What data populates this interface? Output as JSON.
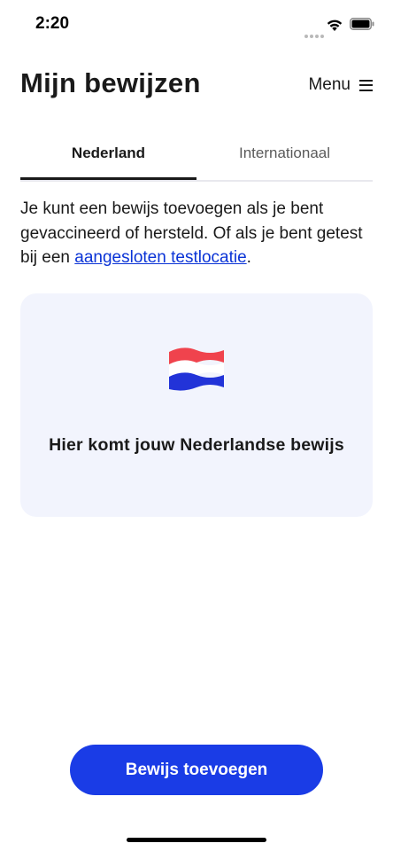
{
  "status_bar": {
    "time": "2:20"
  },
  "header": {
    "title": "Mijn bewijzen",
    "menu_label": "Menu"
  },
  "tabs": [
    {
      "label": "Nederland",
      "selected": true
    },
    {
      "label": "Internationaal",
      "selected": false
    }
  ],
  "intro": {
    "text_before": "Je kunt een bewijs toevoegen als je bent gevaccineerd of hersteld. Of als je bent getest bij een ",
    "link_text": "aangesloten testlocatie",
    "text_after": "."
  },
  "card": {
    "icon": "netherlands-flag-icon",
    "title": "Hier komt jouw Nederlandse bewijs"
  },
  "primary_button": {
    "label": "Bewijs toevoegen"
  },
  "colors": {
    "accent": "#1a3ce6",
    "link": "#0a33d6",
    "card_background": "#f2f4fd",
    "flag_red": "#f0434d",
    "flag_blue": "#2233d8"
  }
}
